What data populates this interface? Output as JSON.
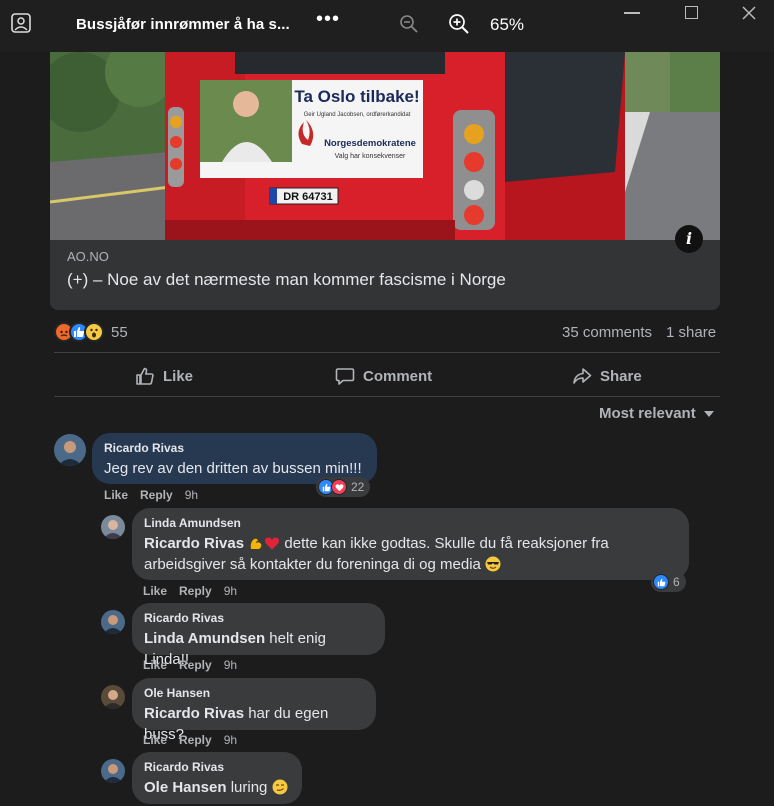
{
  "window": {
    "title": "Bussjåfør innrømmer å ha s...",
    "zoom": "65%"
  },
  "link_card": {
    "source": "AO.NO",
    "title": "(+) – Noe av det nærmeste man kommer fascisme i Norge",
    "image_text": {
      "poster_heading": "Ta Oslo tilbake!",
      "poster_subline": "Geir Ugland Jacobsen, ordførerkandidat",
      "party": "Norgesdemokratene",
      "slogan": "Valg har konsekvenser",
      "plate": "DR 64731"
    }
  },
  "stats": {
    "reaction_count": "55",
    "comments": "35 comments",
    "shares": "1 share"
  },
  "actions": {
    "like": "Like",
    "comment": "Comment",
    "share": "Share"
  },
  "sort": {
    "label": "Most relevant"
  },
  "comments": [
    {
      "author": "Ricardo Rivas",
      "text": "Jeg rev av den dritten av bussen min!!!",
      "like": "Like",
      "reply": "Reply",
      "time": "9h",
      "reactions": "22"
    },
    {
      "author": "Linda Amundsen",
      "mention": "Ricardo Rivas",
      "text_line1": " dette kan ikke godtas. Skulle du få reaksjoner fra",
      "text_line2": "arbeidsgiver så kontakter du foreninga di og media ",
      "like": "Like",
      "reply": "Reply",
      "time": "9h",
      "reactions": "6"
    },
    {
      "author": "Ricardo Rivas",
      "mention": "Linda Amundsen",
      "text": " helt enig Linda!!",
      "like": "Like",
      "reply": "Reply",
      "time": "9h"
    },
    {
      "author": "Ole Hansen",
      "mention": "Ricardo Rivas",
      "text": " har du egen buss?",
      "like": "Like",
      "reply": "Reply",
      "time": "9h"
    },
    {
      "author": "Ricardo Rivas",
      "mention": "Ole Hansen",
      "text": " luring "
    }
  ],
  "colors": {
    "background": "#1c1c1c",
    "bubble": "#3a3b3c",
    "highlight_bubble": "#263951",
    "text": "#e4e6eb",
    "muted": "#b0b3b8",
    "like_blue": "#2e89ff",
    "bus_red": "#d8202a"
  }
}
